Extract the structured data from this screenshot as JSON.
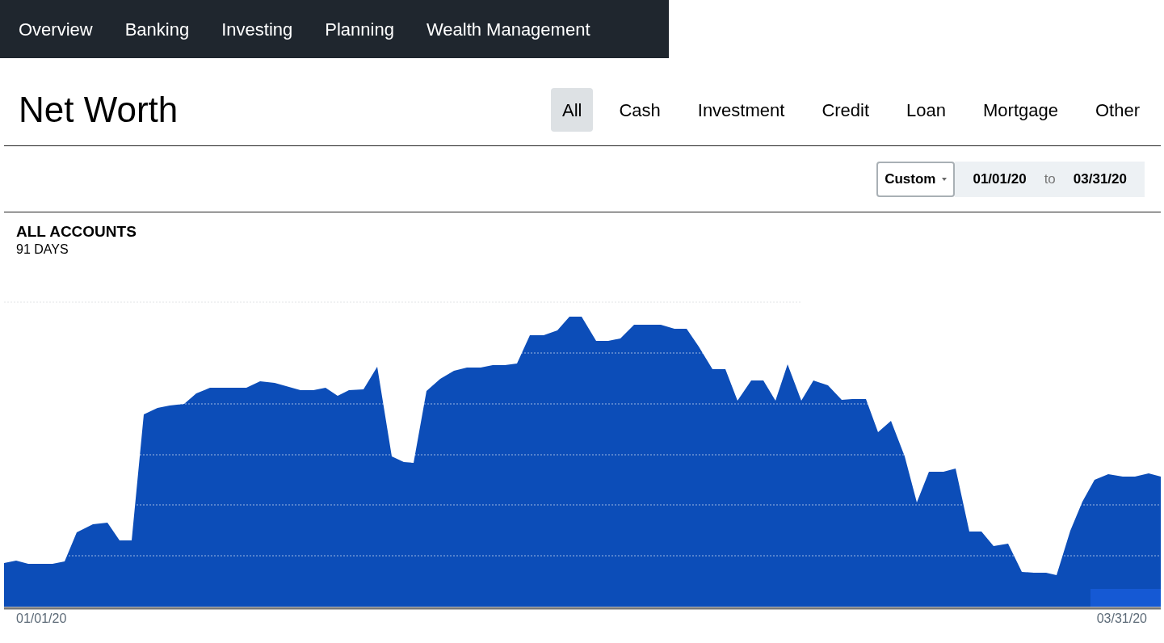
{
  "nav": [
    {
      "label": "Overview"
    },
    {
      "label": "Banking"
    },
    {
      "label": "Investing"
    },
    {
      "label": "Planning"
    },
    {
      "label": "Wealth Management"
    }
  ],
  "title": "Net Worth",
  "filters": [
    {
      "label": "All",
      "selected": true
    },
    {
      "label": "Cash",
      "selected": false
    },
    {
      "label": "Investment",
      "selected": false
    },
    {
      "label": "Credit",
      "selected": false
    },
    {
      "label": "Loan",
      "selected": false
    },
    {
      "label": "Mortgage",
      "selected": false
    },
    {
      "label": "Other",
      "selected": false
    }
  ],
  "range": {
    "preset": "Custom",
    "start": "01/01/20",
    "separator": "to",
    "end": "03/31/20"
  },
  "chart": {
    "title": "ALL ACCOUNTS",
    "subtitle": "91 DAYS",
    "x_start": "01/01/20",
    "x_end": "03/31/20"
  }
}
